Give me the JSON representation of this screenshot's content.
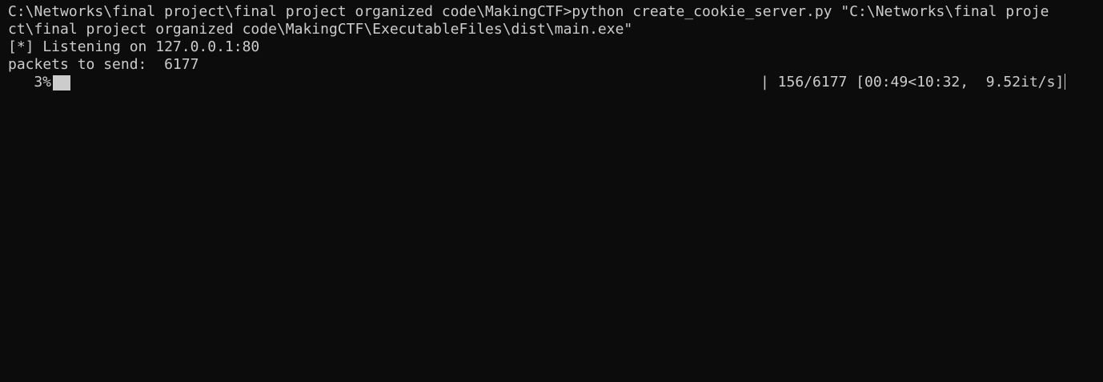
{
  "terminal": {
    "lines": [
      "C:\\Networks\\final project\\final project organized code\\MakingCTF>python create_cookie_server.py \"C:\\Networks\\final proje",
      "ct\\final project organized code\\MakingCTF\\ExecutableFiles\\dist\\main.exe\"",
      "[*] Listening on 127.0.0.1:80",
      "packets to send:  6177"
    ],
    "progress": {
      "percent_text": "3%",
      "bar_separator": "|",
      "fraction": 0.0253,
      "stats": "| 156/6177 [00:49<10:32,  9.52it/s]"
    }
  },
  "colors": {
    "background": "#0c0c0c",
    "foreground": "#cccccc"
  }
}
